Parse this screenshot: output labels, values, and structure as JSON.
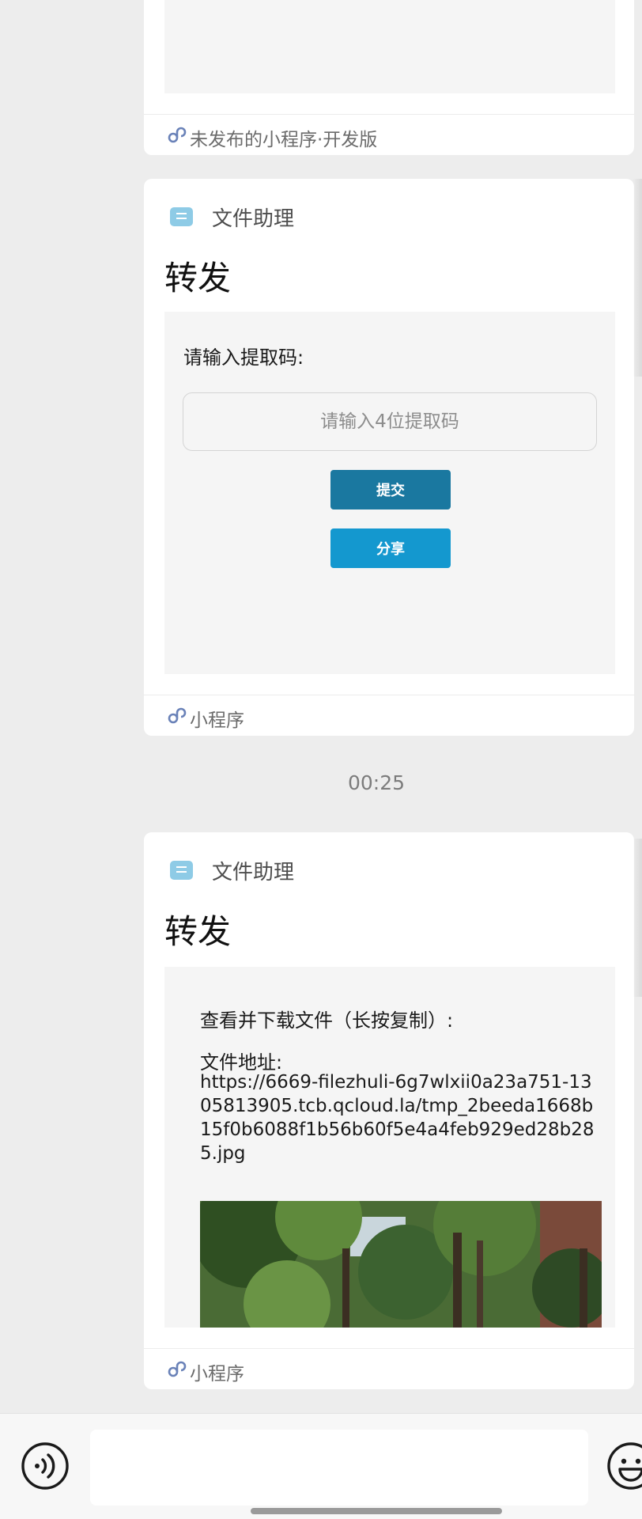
{
  "messages": [
    {
      "footer_label": "未发布的小程序·开发版"
    },
    {
      "app_name": "文件助理",
      "title": "转发",
      "form": {
        "prompt": "请输入提取码:",
        "code_placeholder": "请输入4位提取码",
        "submit_label": "提交",
        "share_label": "分享"
      },
      "footer_label": "小程序"
    },
    {
      "app_name": "文件助理",
      "title": "转发",
      "file": {
        "lead": "查看并下载文件（长按复制）:",
        "address_label": "文件地址:",
        "url": "https://6669-filezhuli-6g7wlxii0a23a751-1305813905.tcb.qcloud.la/tmp_2beeda1668b15f0b6088f1b56b60f5e4a4feb929ed28b285.jpg"
      },
      "footer_label": "小程序"
    }
  ],
  "timestamp": "00:25",
  "colors": {
    "accent_submit": "#1a78a0",
    "accent_share": "#1498cf",
    "app_icon": "#8ecbe6",
    "link_icon": "#6a82b8"
  },
  "icons": {
    "app": "file-helper-icon",
    "footer": "mini-program-link-icon",
    "voice": "voice-input-icon",
    "emoji": "emoji-icon"
  }
}
